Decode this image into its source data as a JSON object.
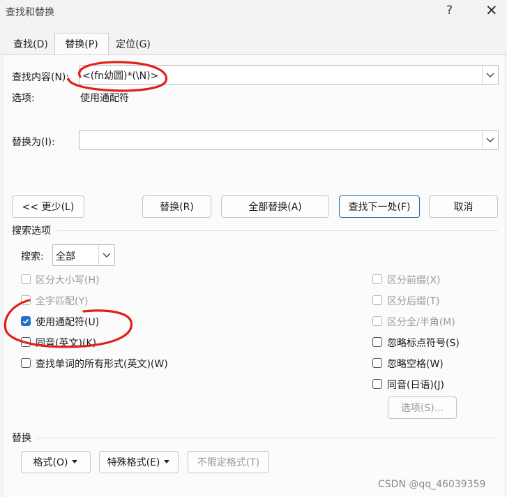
{
  "window": {
    "title": "查找和替换",
    "help_glyph": "?",
    "close_glyph": "✕"
  },
  "tabs": [
    {
      "label": "查找(D)",
      "active": false
    },
    {
      "label": "替换(P)",
      "active": true
    },
    {
      "label": "定位(G)",
      "active": false
    }
  ],
  "find": {
    "label": "查找内容(N):",
    "value": "<(fn幼圆)*(\\N)>"
  },
  "options_row": {
    "label": "选项:",
    "value": "使用通配符"
  },
  "replace": {
    "label": "替换为(I):",
    "value": ""
  },
  "buttons": {
    "less": "<< 更少(L)",
    "replace": "替换(R)",
    "replace_all": "全部替换(A)",
    "find_next": "查找下一处(F)",
    "cancel": "取消"
  },
  "search_options": {
    "section_title": "搜索选项",
    "search_label": "搜索:",
    "search_value": "全部",
    "left": [
      {
        "label": "区分大小写(H)",
        "checked": false,
        "enabled": false
      },
      {
        "label": "全字匹配(Y)",
        "checked": false,
        "enabled": false
      },
      {
        "label": "使用通配符(U)",
        "checked": true,
        "enabled": true
      },
      {
        "label": "同音(英文)(K)",
        "checked": false,
        "enabled": true
      },
      {
        "label": "查找单词的所有形式(英文)(W)",
        "checked": false,
        "enabled": true
      }
    ],
    "right": [
      {
        "label": "区分前缀(X)",
        "checked": false,
        "enabled": false
      },
      {
        "label": "区分后缀(T)",
        "checked": false,
        "enabled": false
      },
      {
        "label": "区分全/半角(M)",
        "checked": false,
        "enabled": false
      },
      {
        "label": "忽略标点符号(S)",
        "checked": false,
        "enabled": true
      },
      {
        "label": "忽略空格(W)",
        "checked": false,
        "enabled": true
      },
      {
        "label": "同音(日语)(J)",
        "checked": false,
        "enabled": true
      }
    ],
    "options_button": "选项(S)..."
  },
  "replace_section": {
    "title": "替换",
    "format_button": "格式(O)",
    "special_button": "特殊格式(E)",
    "no_format_button": "不限定格式(T)"
  },
  "watermark": "CSDN @qq_46039359",
  "annotation_color": "#e0211b",
  "accent_color": "#1f6fc5"
}
